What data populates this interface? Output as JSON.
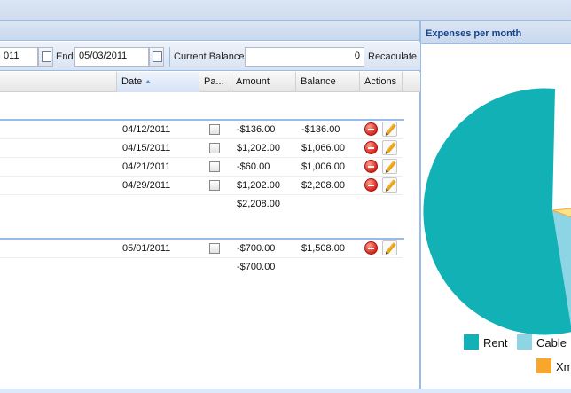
{
  "toolbar": {
    "start_value": "011",
    "end_label": "End",
    "end_value": "05/03/2011",
    "balance_label": "Current Balance",
    "balance_value": "0",
    "recalculate_label": "Recaculate"
  },
  "columns": [
    "Date",
    "Pa...",
    "Amount",
    "Balance",
    "Actions"
  ],
  "groups": [
    {
      "rows": [
        {
          "date": "04/12/2011",
          "amount": "-$136.00",
          "balance": "-$136.00"
        },
        {
          "date": "04/15/2011",
          "amount": "$1,202.00",
          "balance": "$1,066.00"
        },
        {
          "date": "04/21/2011",
          "amount": "-$60.00",
          "balance": "$1,006.00"
        },
        {
          "date": "04/29/2011",
          "amount": "$1,202.00",
          "balance": "$2,208.00"
        }
      ],
      "summary": "$2,208.00"
    },
    {
      "rows": [
        {
          "date": "05/01/2011",
          "amount": "-$700.00",
          "balance": "$1,508.00"
        }
      ],
      "summary": "-$700.00"
    }
  ],
  "chart": {
    "title": "Expenses per month",
    "legend": [
      {
        "label": "Rent",
        "color": "#11b1b6"
      },
      {
        "label": "Cable",
        "color": "#8dd4e5"
      },
      {
        "label": "Xm",
        "color": "#f9a62d"
      }
    ]
  },
  "colors": {
    "panel_border": "#99bbe8",
    "header_text": "#15428b",
    "pie_highlight": "#fbe38a"
  },
  "icons": {
    "delete": "minus-circle-icon",
    "edit": "pencil-icon",
    "date_picker": "calendar-icon"
  }
}
